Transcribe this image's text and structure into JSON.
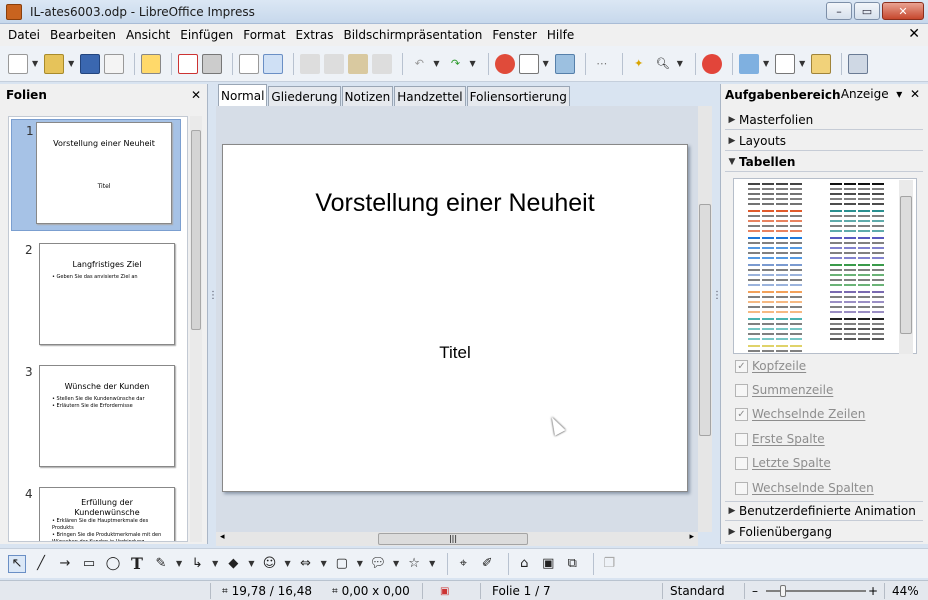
{
  "window": {
    "title": "IL-ates6003.odp - LibreOffice Impress",
    "minimize": "–",
    "maximize": "▭",
    "close": "✕"
  },
  "menu": {
    "items": [
      "Datei",
      "Bearbeiten",
      "Ansicht",
      "Einfügen",
      "Format",
      "Extras",
      "Bildschirmpräsentation",
      "Fenster",
      "Hilfe"
    ],
    "close": "✕"
  },
  "slides_pane": {
    "title": "Folien",
    "close": "✕",
    "slides": [
      {
        "number": "1",
        "title": "Vorstellung einer Neuheit",
        "subtitle": "Titel",
        "bullets": []
      },
      {
        "number": "2",
        "title": "Langfristiges Ziel",
        "subtitle": "",
        "bullets": [
          "Geben Sie das anvisierte Ziel an"
        ]
      },
      {
        "number": "3",
        "title": "Wünsche der Kunden",
        "subtitle": "",
        "bullets": [
          "Stellen Sie die Kundenwünsche dar",
          "Erläutern Sie die Erfordernisse"
        ]
      },
      {
        "number": "4",
        "title": "Erfüllung der Kundenwünsche",
        "subtitle": "",
        "bullets": [
          "Erklären Sie die Hauptmerkmale des Produkts",
          "Bringen Sie die Produktmerkmale mit den Wünschen der Kunden in Verbindung"
        ]
      }
    ]
  },
  "view_tabs": [
    "Normal",
    "Gliederung",
    "Notizen",
    "Handzettel",
    "Foliensortierung"
  ],
  "active_tab": "Normal",
  "slide": {
    "title": "Vorstellung einer Neuheit",
    "subtitle": "Titel"
  },
  "task_pane": {
    "title": "Aufgabenbereich",
    "view_label": "Anzeige",
    "sections_top": [
      "Masterfolien",
      "Layouts",
      "Tabellen"
    ],
    "open_section": "Tabellen",
    "options": [
      {
        "label": "Kopfzeile",
        "checked": true
      },
      {
        "label": "Summenzeile",
        "checked": false
      },
      {
        "label": "Wechselnde Zeilen",
        "checked": true
      },
      {
        "label": "Erste Spalte",
        "checked": false
      },
      {
        "label": "Letzte Spalte",
        "checked": false
      },
      {
        "label": "Wechselnde Spalten",
        "checked": false
      }
    ],
    "sections_bottom": [
      "Benutzerdefinierte Animation",
      "Folienübergang"
    ],
    "table_styles_left": [
      "#444444",
      "#e05a2b",
      "#1f78d8",
      "#7a9ad0",
      "#f2a15a",
      "#4ab3b0",
      "#e0d36a"
    ],
    "table_styles_right": [
      "#111111",
      "#2a8f8f",
      "#5a5abf",
      "#3a9a4a",
      "#7a6ab0",
      "#222222"
    ]
  },
  "status": {
    "position": "19,78 / 16,48",
    "size": "0,00 x 0,00",
    "slide": "Folie 1 / 7",
    "layout": "Standard",
    "zoom": "44%",
    "zoom_minus": "–",
    "zoom_plus": "+"
  }
}
